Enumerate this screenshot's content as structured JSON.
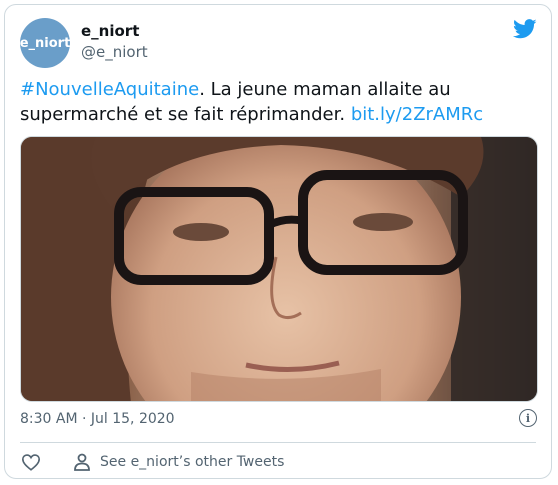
{
  "tweet": {
    "avatar_text": "e_niort",
    "display_name": "e_niort",
    "handle": "@e_niort",
    "hashtag": "#NouvelleAquitaine",
    "body": ". La jeune maman allaite au supermarché et se fait réprimander.",
    "link": "bit.ly/2ZrAMRc",
    "timestamp": "8:30 AM · Jul 15, 2020",
    "info_icon": "info-icon",
    "see_more_label": "See e_niort’s other Tweets"
  },
  "colors": {
    "link": "#1d9bf0",
    "muted": "#536471",
    "border": "#cfd9de",
    "avatar": "#6a9ec9"
  }
}
